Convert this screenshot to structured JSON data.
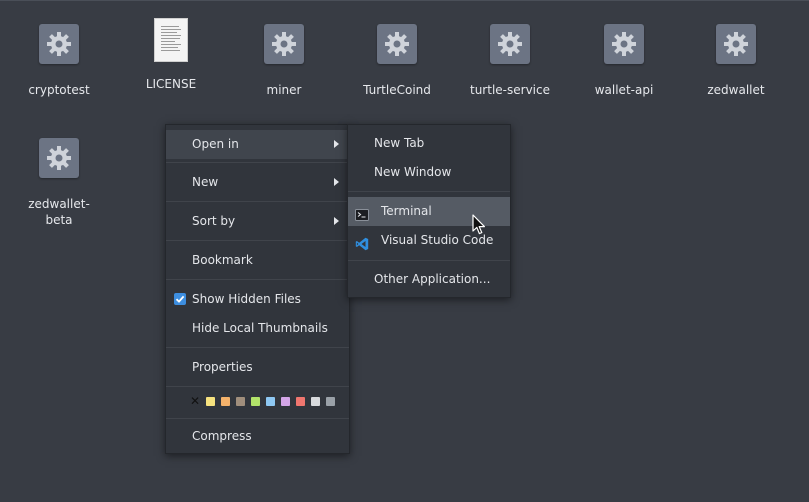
{
  "desktop": {
    "files": [
      {
        "name": "cryptotest",
        "type": "executable",
        "icon": "gear-icon"
      },
      {
        "name": "LICENSE",
        "type": "document",
        "icon": "document-icon"
      },
      {
        "name": "miner",
        "type": "executable",
        "icon": "gear-icon"
      },
      {
        "name": "TurtleCoind",
        "type": "executable",
        "icon": "gear-icon"
      },
      {
        "name": "turtle-service",
        "type": "executable",
        "icon": "gear-icon"
      },
      {
        "name": "wallet-api",
        "type": "executable",
        "icon": "gear-icon"
      },
      {
        "name": "zedwallet",
        "type": "executable",
        "icon": "gear-icon"
      },
      {
        "name": "zedwallet-\nbeta",
        "type": "executable",
        "icon": "gear-icon"
      }
    ]
  },
  "context_menu": {
    "open_in": "Open in",
    "new": "New",
    "sort_by": "Sort by",
    "bookmark": "Bookmark",
    "show_hidden_files": "Show Hidden Files",
    "show_hidden_checked": true,
    "hide_local_thumbnails": "Hide Local Thumbnails",
    "properties": "Properties",
    "compress": "Compress",
    "color_tags": [
      "#f6e27f",
      "#f4b26b",
      "#a08e7c",
      "#b2e36a",
      "#8ec8f3",
      "#d4a6e8",
      "#f0766f",
      "#d8dadd",
      "#9aa1a8"
    ]
  },
  "submenu": {
    "new_tab": "New Tab",
    "new_window": "New Window",
    "terminal": "Terminal",
    "vscode": "Visual Studio Code",
    "other_application": "Other Application..."
  },
  "colors": {
    "background": "#383c44",
    "menu_bg": "#31353c",
    "highlight": "#555b64",
    "accent": "#3d8ee0",
    "vscode_blue": "#2f8fe0"
  }
}
